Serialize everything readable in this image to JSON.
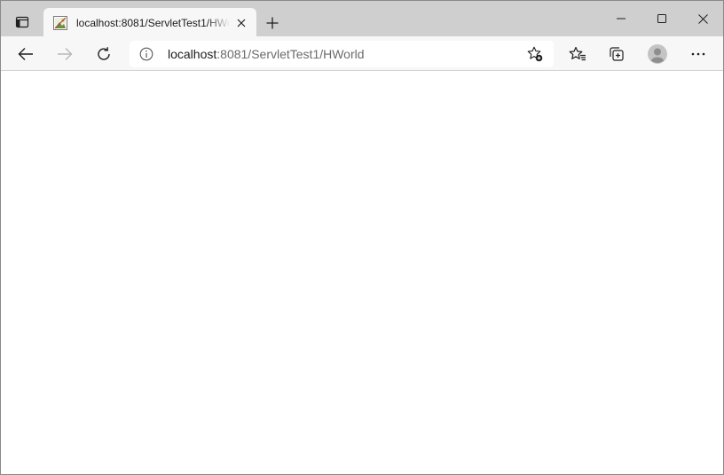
{
  "tab": {
    "title": "localhost:8081/ServletTest1/HWorld",
    "favicon": "broken-image-icon"
  },
  "address_bar": {
    "url_host": "localhost",
    "url_rest": ":8081/ServletTest1/HWorld"
  },
  "icons": {
    "tab_actions": "tab-actions-icon",
    "tab_close": "close-icon",
    "new_tab": "plus-icon",
    "minimize": "minimize-icon",
    "maximize": "maximize-icon",
    "close_window": "close-icon",
    "back": "arrow-left-icon",
    "forward": "arrow-right-icon",
    "refresh": "refresh-icon",
    "site_info": "info-icon",
    "add_favorite": "star-plus-icon",
    "favorites": "favorites-icon",
    "collections": "collections-icon",
    "profile": "avatar-icon",
    "more": "more-icon"
  },
  "colors": {
    "tabstrip": "#cfcfcf",
    "toolbar": "#f7f7f7",
    "active_tab": "#f7f7f7",
    "content": "#ffffff"
  },
  "content": {}
}
